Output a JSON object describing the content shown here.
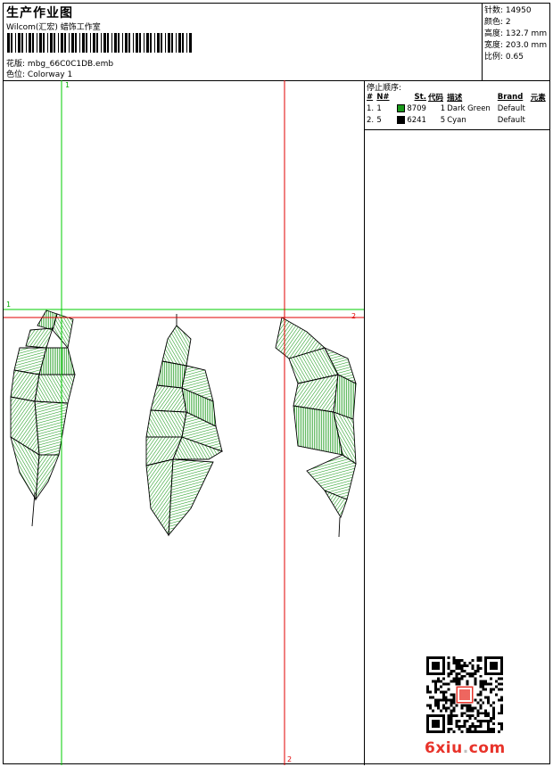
{
  "header": {
    "title": "生产作业图",
    "subtitle": "Wilcom(汇宏) 蜡饰工作室",
    "design_label": "花版:",
    "design_file": "mbg_66C0C1DB.emb",
    "colorway_label": "色位:",
    "colorway": "Colorway 1"
  },
  "stats": [
    {
      "label": "针数:",
      "value": "14950"
    },
    {
      "label": "颜色:",
      "value": "2"
    },
    {
      "label": "高度:",
      "value": "132.7 mm"
    },
    {
      "label": "宽度:",
      "value": "203.0 mm"
    },
    {
      "label": "比例:",
      "value": "0.65"
    }
  ],
  "stop_sequence": {
    "title": "停止顺序:",
    "columns": [
      "#",
      "N#",
      "St.",
      "代码",
      "描述",
      "Brand",
      "元素"
    ],
    "rows": [
      {
        "index": "1.",
        "n": "1",
        "color": "#1a9a1a",
        "st": "8709",
        "code": "1",
        "desc": "Dark Green",
        "brand": "Default"
      },
      {
        "index": "2.",
        "n": "5",
        "color": "#000000",
        "st": "6241",
        "code": "5",
        "desc": "Cyan",
        "brand": "Default"
      }
    ]
  },
  "guides": {
    "green_v_label": "1",
    "green_h_label": "1",
    "red_h_label": "2",
    "red_v_label": "2"
  },
  "colors": {
    "guide_green": "#00cc00",
    "guide_red": "#e00000",
    "stitch_green": "#1a9a1a"
  },
  "watermark": {
    "site_prefix": "6xiu",
    "site_dot": ".",
    "site_suffix": "com"
  }
}
